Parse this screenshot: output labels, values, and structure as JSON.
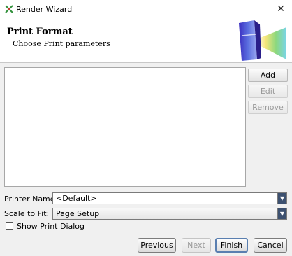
{
  "window": {
    "title": "Render Wizard",
    "close_glyph": "✕",
    "app_icon": "render-wizard-app-icon"
  },
  "header": {
    "title": "Print Format",
    "subtitle": "Choose Print parameters",
    "logo_icon": "prism-logo-icon"
  },
  "side_buttons": {
    "add": "Add",
    "edit": "Edit",
    "remove": "Remove"
  },
  "printer": {
    "label": "Printer Name:",
    "value": "<Default>"
  },
  "scale": {
    "label": "Scale to Fit:",
    "value": "Page Setup"
  },
  "show_dialog": {
    "label": "Show Print Dialog",
    "checked": false
  },
  "footer": {
    "previous": "Previous",
    "next": "Next",
    "finish": "Finish",
    "cancel": "Cancel"
  },
  "colors": {
    "accent": "#3d5170",
    "logo_blue": "#2a3fa8"
  }
}
